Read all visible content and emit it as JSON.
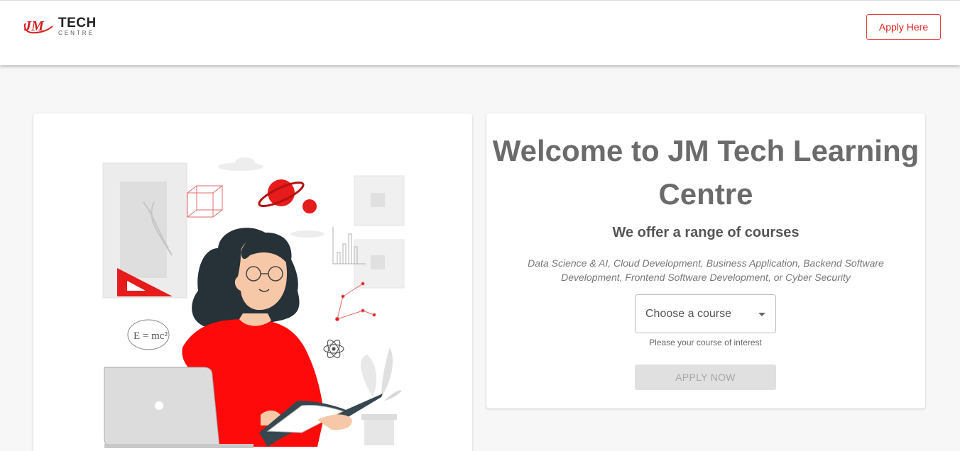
{
  "header": {
    "logo": {
      "monogram": "JM",
      "name": "TECH",
      "tagline": "CENTRE"
    },
    "apply_here_label": "Apply Here",
    "accent_color": "#e02020"
  },
  "hero": {
    "illustration": {
      "formula": "E = mc²",
      "theme": "woman-reading-science-illustration"
    }
  },
  "welcome": {
    "title": "Welcome to JM Tech Learning Centre",
    "subtitle": "We offer a range of courses",
    "courses_text": "Data Science & AI, Cloud Development, Business Application, Backend Software Development, Frontend Software Development, or Cyber Security",
    "course_select": {
      "value": "Choose a course",
      "helper": "Please your course of interest"
    },
    "apply_now_label": "APPLY NOW"
  },
  "icons": {
    "dropdown": "caret-down-icon",
    "atom": "atom-icon",
    "planet": "planet-icon"
  }
}
